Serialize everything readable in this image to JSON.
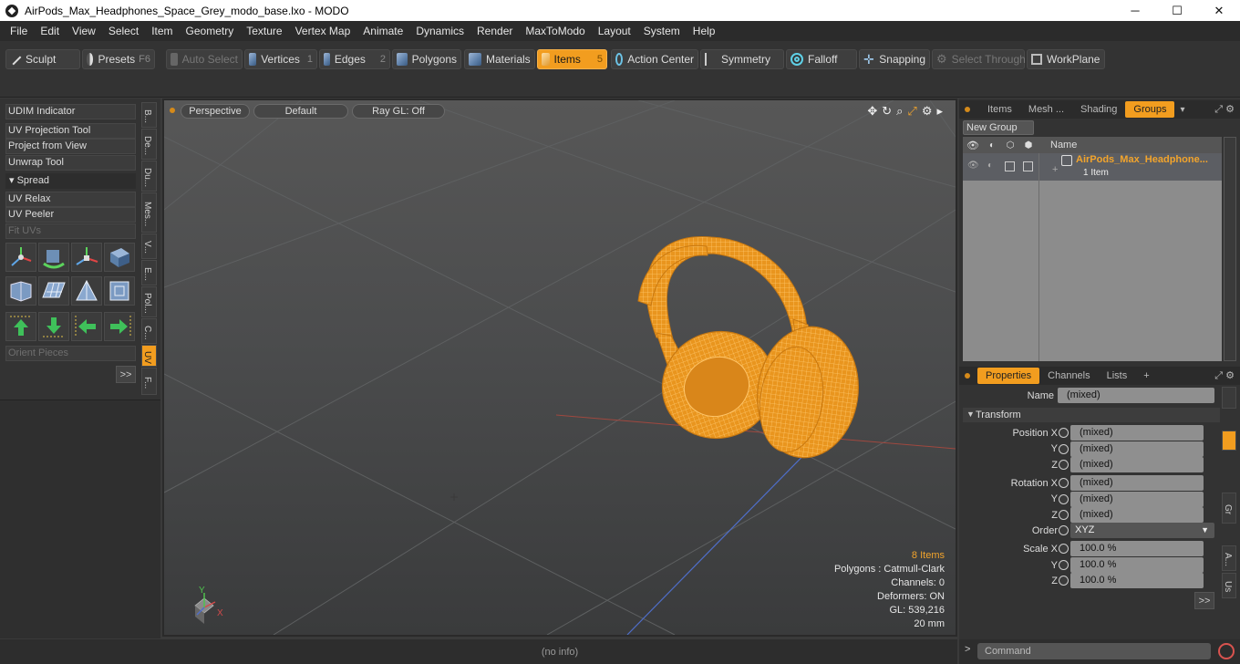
{
  "window": {
    "title": "AirPods_Max_Headphones_Space_Grey_modo_base.lxo - MODO",
    "minimize": "─",
    "maximize": "☐",
    "close": "✕"
  },
  "menu": [
    "File",
    "Edit",
    "View",
    "Select",
    "Item",
    "Geometry",
    "Texture",
    "Vertex Map",
    "Animate",
    "Dynamics",
    "Render",
    "MaxToModo",
    "Layout",
    "System",
    "Help"
  ],
  "toolbar": {
    "sculpt": "Sculpt",
    "presets": "Presets",
    "presets_key": "F6",
    "auto_select": "Auto Select",
    "vertices": "Vertices",
    "vertices_num": "1",
    "edges": "Edges",
    "edges_num": "2",
    "polygons": "Polygons",
    "materials": "Materials",
    "items": "Items",
    "items_num": "5",
    "action_center": "Action Center",
    "symmetry": "Symmetry",
    "falloff": "Falloff",
    "snapping": "Snapping",
    "select_through": "Select Through",
    "workplane": "WorkPlane"
  },
  "leftpanel": {
    "udim": "UDIM Indicator",
    "uv_projection": "UV Projection Tool",
    "project_from_view": "Project from View",
    "unwrap": "Unwrap Tool",
    "spread": "Spread",
    "uv_relax": "UV Relax",
    "uv_peeler": "UV Peeler",
    "fit_uvs": "Fit UVs",
    "orient_pieces": "Orient Pieces",
    "more": ">>",
    "vtabs": [
      "B...",
      "De...",
      "Du...",
      "Mes...",
      "V...",
      "E...",
      "Pol...",
      "C...",
      "UV",
      "F..."
    ]
  },
  "viewport": {
    "view": "Perspective",
    "shading": "Default",
    "raygl": "Ray GL: Off",
    "stats": {
      "items": "8 Items",
      "polygons": "Polygons : Catmull-Clark",
      "channels": "Channels: 0",
      "deformers": "Deformers: ON",
      "gl": "GL: 539,216",
      "scale": "20 mm"
    },
    "axis_x": "X",
    "axis_y": "Y"
  },
  "status": {
    "info": "(no info)"
  },
  "groups_panel": {
    "tabs": [
      "Items",
      "Mesh ...",
      "Shading",
      "Groups"
    ],
    "active_tab": "Groups",
    "new_group": "New Group",
    "col_name": "Name",
    "group_name": "AirPods_Max_Headphone...",
    "group_count": "1 Item"
  },
  "properties_panel": {
    "tabs": [
      "Properties",
      "Channels",
      "Lists"
    ],
    "add": "+",
    "name_label": "Name",
    "name_value": "(mixed)",
    "transform": "Transform",
    "position_x_label": "Position X",
    "rotation_x_label": "Rotation X",
    "scale_x_label": "Scale X",
    "y": "Y",
    "z": "Z",
    "order_label": "Order",
    "order_value": "XYZ",
    "mixed": "(mixed)",
    "scale_value": "100.0 %",
    "more": ">>",
    "side_tabs": [
      "Gr",
      "A...",
      "Us"
    ]
  },
  "command": {
    "placeholder": "Command",
    "prompt": ">"
  },
  "colors": {
    "accent": "#f29d1f",
    "mesh": "#f5a623"
  }
}
